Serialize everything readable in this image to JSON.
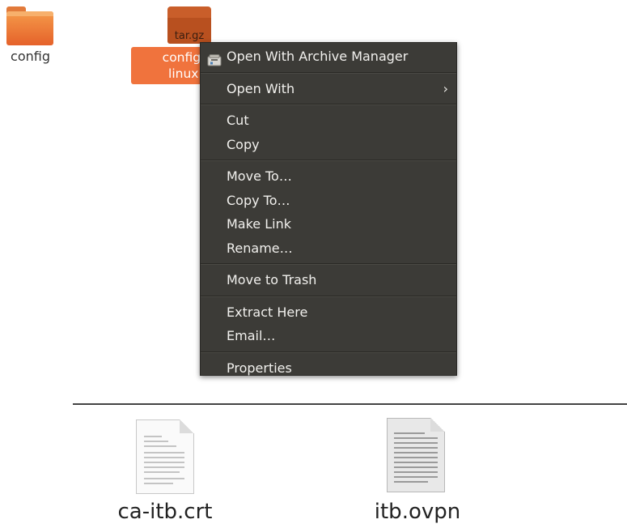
{
  "desktop": {
    "folder_label": "config",
    "archive_ext": "tar.gz",
    "archive_label_line1": "config-op",
    "archive_label_line2": "linux.ta"
  },
  "context_menu": {
    "open_with_archive_manager": "Open With Archive Manager",
    "open_with": "Open With",
    "cut": "Cut",
    "copy": "Copy",
    "move_to": "Move To…",
    "copy_to": "Copy To…",
    "make_link": "Make Link",
    "rename": "Rename…",
    "move_to_trash": "Move to Trash",
    "extract_here": "Extract Here",
    "email": "Email…",
    "properties": "Properties"
  },
  "files_below": [
    {
      "name": "ca-itb.crt"
    },
    {
      "name": "itb.ovpn"
    }
  ],
  "colors": {
    "menu_background": "#3c3b37",
    "menu_text": "#f2f1ee",
    "selection_orange": "#f0733d"
  },
  "icons": {
    "folder": "folder-icon",
    "archive": "archive-tar-gz-icon",
    "archive_manager": "archive-manager-icon",
    "submenu": "chevron-right-icon",
    "document": "text-document-icon"
  }
}
